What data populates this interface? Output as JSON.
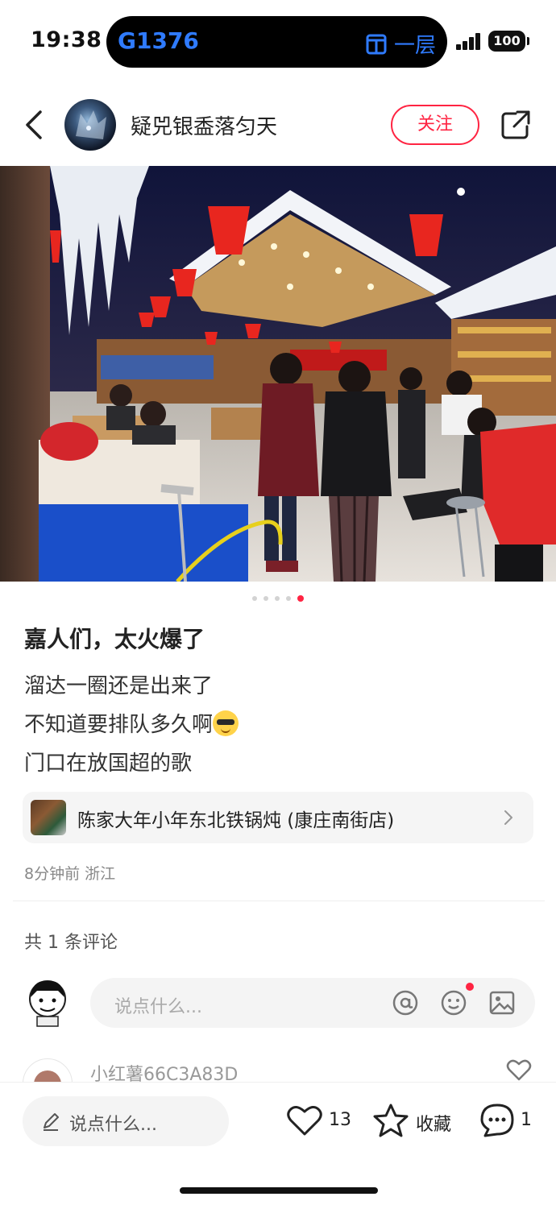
{
  "status_bar": {
    "time": "19:38",
    "island_left": "G1376",
    "island_right": "一层",
    "battery": "100"
  },
  "header": {
    "username": "疑兕银盉落匀天",
    "follow_label": "关注"
  },
  "carousel": {
    "total": 5,
    "active_index": 4
  },
  "post": {
    "title": "嘉人们，太火爆了",
    "lines": [
      "溜达一圈还是出来了",
      "不知道要排队多久啊",
      "门口在放国超的歌"
    ],
    "shop_name": "陈家大年小年东北铁锅炖 (康庄南街店)",
    "time": "8分钟前",
    "location": "浙江"
  },
  "comments": {
    "count_label": "共 1 条评论",
    "input_placeholder": "说点什么...",
    "first_commenter": "小红薯66C3A83D"
  },
  "bottom_bar": {
    "input_placeholder": "说点什么...",
    "like_count": "13",
    "collect_label": "收藏",
    "comment_count": "1"
  },
  "colors": {
    "accent": "#ff2442",
    "island_text": "#2f7bff"
  }
}
